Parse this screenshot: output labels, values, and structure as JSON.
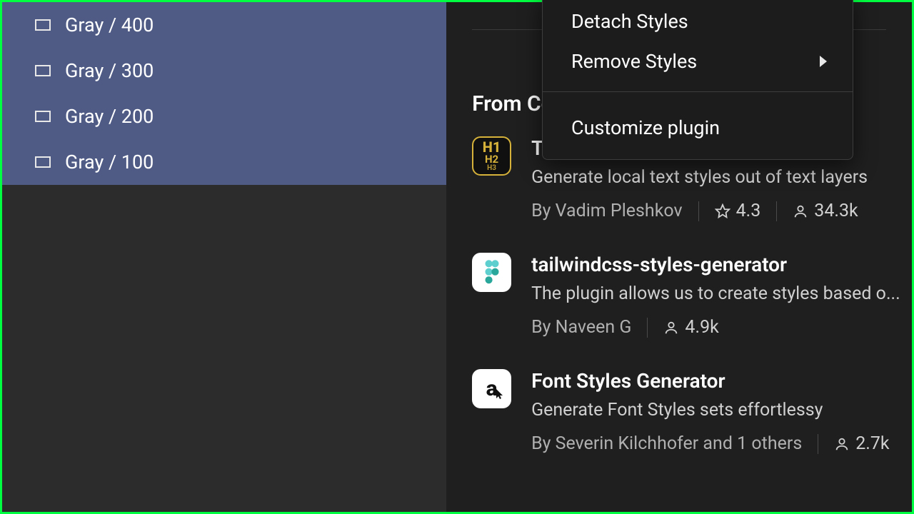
{
  "sidebar": {
    "layers": [
      {
        "label": "Gray / 400"
      },
      {
        "label": "Gray / 300"
      },
      {
        "label": "Gray / 200"
      },
      {
        "label": "Gray / 100"
      }
    ]
  },
  "context_menu": {
    "items": [
      {
        "label": "Detach Styles",
        "has_submenu": false
      },
      {
        "label": "Remove Styles",
        "has_submenu": true
      }
    ],
    "footer_item": {
      "label": "Customize plugin"
    }
  },
  "community": {
    "section_title": "From Community",
    "plugins": [
      {
        "name_visible_prefix": "T",
        "description": "Generate local text styles out of text layers",
        "author": "By Vadim Pleshkov",
        "rating": "4.3",
        "users": "34.3k",
        "icon": "h1"
      },
      {
        "name": "tailwindcss-styles-generator",
        "description": "The plugin allows us to create styles based o...",
        "author": "By Naveen G",
        "users": "4.9k",
        "icon": "figma"
      },
      {
        "name": "Font Styles Generator",
        "description": "Generate Font Styles sets effortlessy",
        "author": "By Severin Kilchhofer and 1 others",
        "users": "2.7k",
        "icon": "a"
      }
    ]
  },
  "colors": {
    "selection": "#4f5b85",
    "panel_bg": "#2c2c2c",
    "main_bg": "#1f1f1f",
    "menu_bg": "#1c1c1c"
  }
}
